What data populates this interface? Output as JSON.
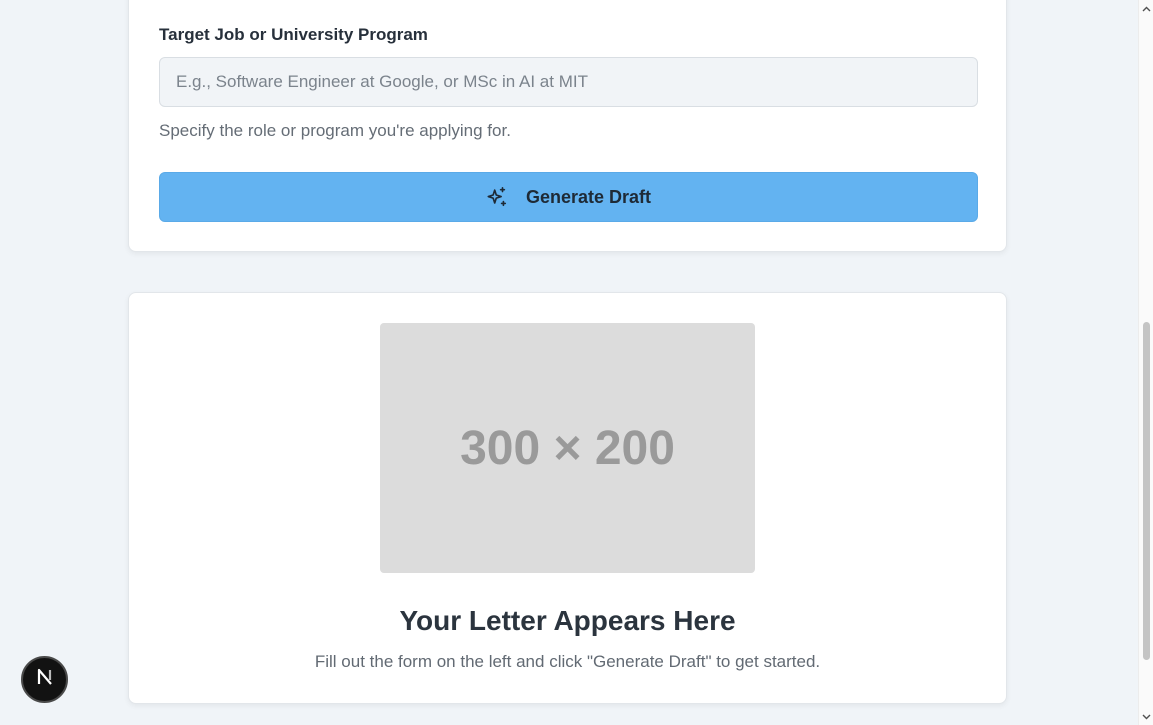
{
  "form": {
    "target_label": "Target Job or University Program",
    "target_placeholder": "E.g., Software Engineer at Google, or MSc in AI at MIT",
    "target_value": "",
    "target_hint": "Specify the role or program you're applying for.",
    "generate_label": "Generate Draft",
    "generate_icon": "sparkles-icon"
  },
  "preview": {
    "image_placeholder_text": "300 × 200",
    "title": "Your Letter Appears Here",
    "subtitle": "Fill out the form on the left and click \"Generate Draft\" to get started."
  },
  "dev_badge": {
    "letter": "N",
    "icon": "nextjs-logo-icon"
  },
  "colors": {
    "page_bg": "#f0f4f8",
    "card_bg": "#ffffff",
    "button_bg": "#63b3f1",
    "input_bg": "#f1f4f7",
    "badge_bg": "#121212"
  }
}
